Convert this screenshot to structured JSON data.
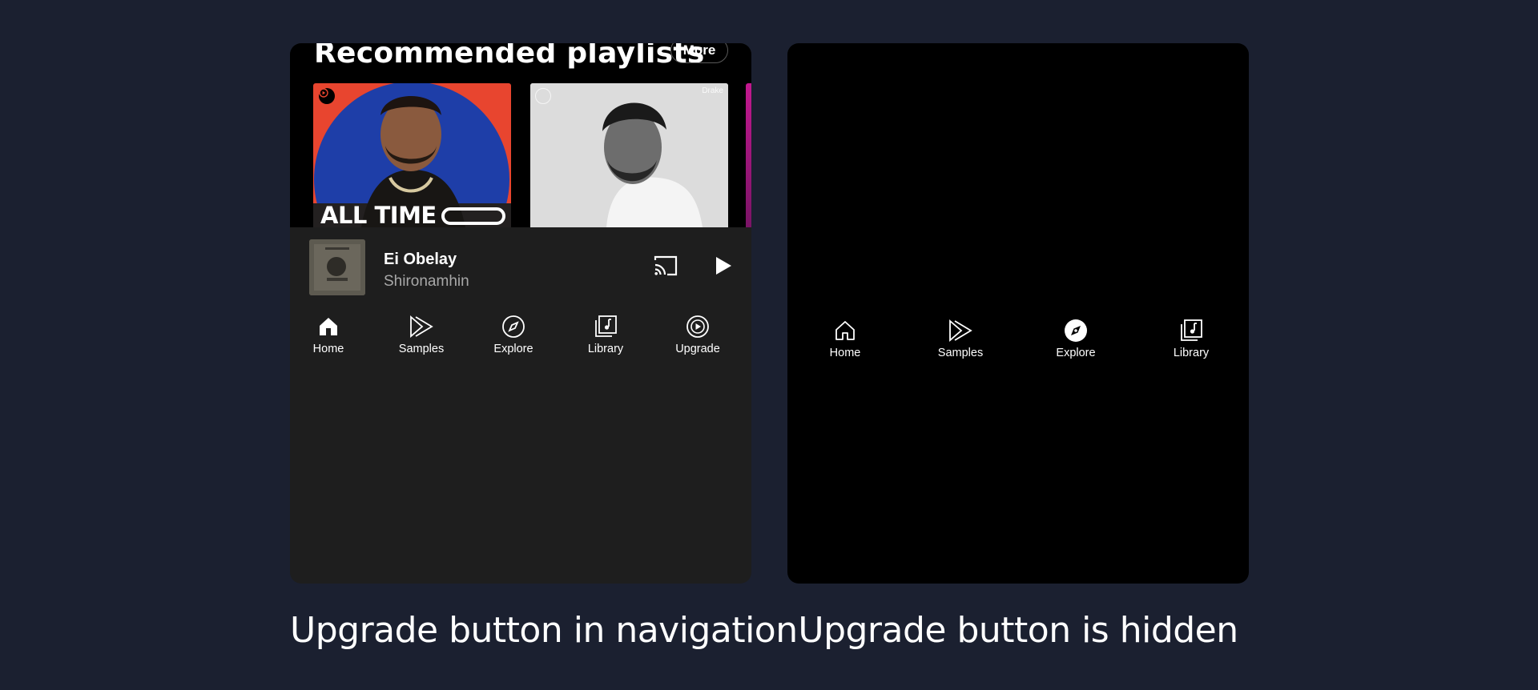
{
  "left_panel": {
    "section_title": "Recommended playlists",
    "more_label": "More",
    "covers": [
      {
        "title": "ALL TIME",
        "brand_color": "#e8452f"
      },
      {
        "artist_label": "Drake"
      }
    ],
    "now_playing": {
      "title": "Ei Obelay",
      "artist": "Shironamhin"
    },
    "nav": [
      {
        "label": "Home",
        "icon": "home-icon",
        "active": true
      },
      {
        "label": "Samples",
        "icon": "samples-icon",
        "active": false
      },
      {
        "label": "Explore",
        "icon": "explore-icon",
        "active": false
      },
      {
        "label": "Library",
        "icon": "library-icon",
        "active": false
      },
      {
        "label": "Upgrade",
        "icon": "upgrade-icon",
        "active": false
      }
    ],
    "caption": "Upgrade button in navigation"
  },
  "right_panel": {
    "nav": [
      {
        "label": "Home",
        "icon": "home-icon",
        "active": false
      },
      {
        "label": "Samples",
        "icon": "samples-icon",
        "active": false
      },
      {
        "label": "Explore",
        "icon": "explore-icon",
        "active": true
      },
      {
        "label": "Library",
        "icon": "library-icon",
        "active": false
      }
    ],
    "caption": "Upgrade button is hidden"
  },
  "colors": {
    "page_background": "#1b2030",
    "left_panel_background": "#1e1e1e",
    "right_panel_background": "#000000"
  }
}
